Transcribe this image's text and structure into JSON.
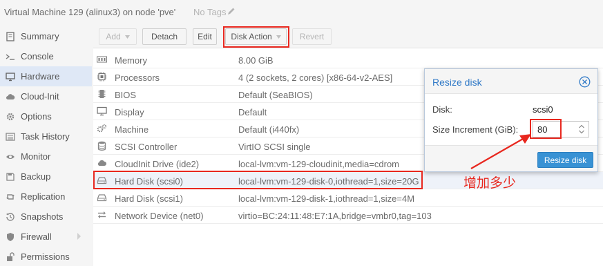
{
  "header": {
    "title": "Virtual Machine 129 (alinux3) on node 'pve'",
    "tags": "No Tags"
  },
  "sidebar": {
    "items": [
      {
        "label": "Summary",
        "icon": "book-icon"
      },
      {
        "label": "Console",
        "icon": "terminal-icon"
      },
      {
        "label": "Hardware",
        "icon": "desktop-icon",
        "active": true
      },
      {
        "label": "Cloud-Init",
        "icon": "cloud-icon"
      },
      {
        "label": "Options",
        "icon": "gear-icon"
      },
      {
        "label": "Task History",
        "icon": "list-icon"
      },
      {
        "label": "Monitor",
        "icon": "eye-icon"
      },
      {
        "label": "Backup",
        "icon": "floppy-icon"
      },
      {
        "label": "Replication",
        "icon": "retweet-icon"
      },
      {
        "label": "Snapshots",
        "icon": "history-icon"
      },
      {
        "label": "Firewall",
        "icon": "shield-icon"
      },
      {
        "label": "Permissions",
        "icon": "unlock-icon"
      }
    ]
  },
  "toolbar": {
    "add_label": "Add",
    "detach_label": "Detach",
    "edit_label": "Edit",
    "disk_action_label": "Disk Action",
    "revert_label": "Revert"
  },
  "hardware": {
    "rows": [
      {
        "key": "Memory",
        "value": "8.00 GiB",
        "icon": "memory-icon"
      },
      {
        "key": "Processors",
        "value": "4 (2 sockets, 2 cores) [x86-64-v2-AES]",
        "icon": "cpu-icon"
      },
      {
        "key": "BIOS",
        "value": "Default (SeaBIOS)",
        "icon": "microchip-icon"
      },
      {
        "key": "Display",
        "value": "Default",
        "icon": "desktop-icon"
      },
      {
        "key": "Machine",
        "value": "Default (i440fx)",
        "icon": "cogs-icon"
      },
      {
        "key": "SCSI Controller",
        "value": "VirtIO SCSI single",
        "icon": "database-icon"
      },
      {
        "key": "CloudInit Drive (ide2)",
        "value": "local-lvm:vm-129-cloudinit,media=cdrom",
        "icon": "cloud-icon"
      },
      {
        "key": "Hard Disk (scsi0)",
        "value": "local-lvm:vm-129-disk-0,iothread=1,size=20G",
        "icon": "hdd-icon",
        "selected": true
      },
      {
        "key": "Hard Disk (scsi1)",
        "value": "local-lvm:vm-129-disk-1,iothread=1,size=4M",
        "icon": "hdd-icon"
      },
      {
        "key": "Network Device (net0)",
        "value": "virtio=BC:24:11:48:E7:1A,bridge=vmbr0,tag=103",
        "icon": "exchange-icon"
      }
    ]
  },
  "dialog": {
    "title": "Resize disk",
    "disk_label": "Disk:",
    "disk_value": "scsi0",
    "size_label": "Size Increment (GiB):",
    "size_value": "80",
    "submit_label": "Resize disk"
  },
  "annotation": {
    "text": "增加多少",
    "color": "#e8271e"
  },
  "colors": {
    "accent": "#3892d4",
    "title_blue": "#3079c7",
    "selected_row": "#eef2f9",
    "active_nav": "#dfe8f6"
  }
}
